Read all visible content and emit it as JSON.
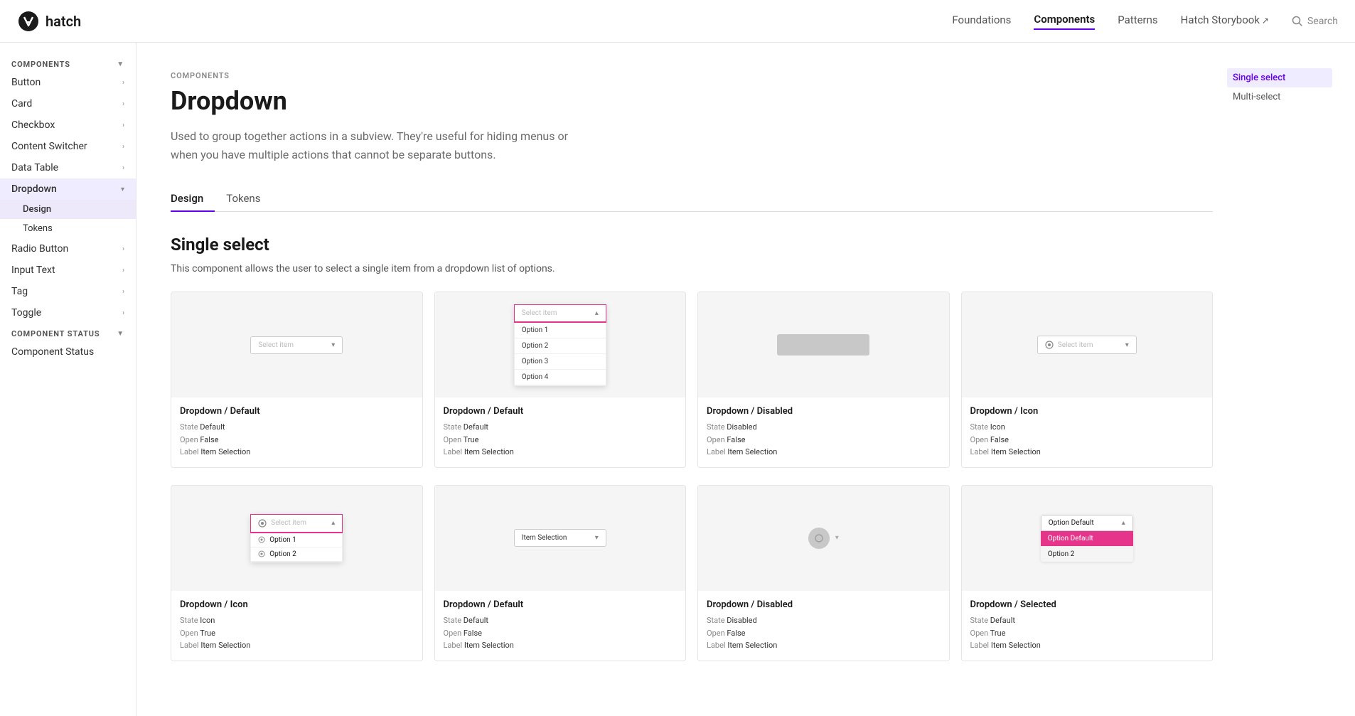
{
  "header": {
    "logo_text": "hatch",
    "nav_items": [
      {
        "label": "Foundations",
        "active": false,
        "external": false
      },
      {
        "label": "Components",
        "active": true,
        "external": false
      },
      {
        "label": "Patterns",
        "active": false,
        "external": false
      },
      {
        "label": "Hatch Storybook",
        "active": false,
        "external": true
      }
    ],
    "search_label": "Search"
  },
  "sidebar": {
    "components_section": "COMPONENTS",
    "items": [
      {
        "label": "Button",
        "active": false,
        "expanded": false
      },
      {
        "label": "Card",
        "active": false,
        "expanded": false
      },
      {
        "label": "Checkbox",
        "active": false,
        "expanded": false
      },
      {
        "label": "Content Switcher",
        "active": false,
        "expanded": false
      },
      {
        "label": "Data Table",
        "active": false,
        "expanded": false
      },
      {
        "label": "Dropdown",
        "active": true,
        "expanded": true
      },
      {
        "label": "Radio Button",
        "active": false,
        "expanded": false
      },
      {
        "label": "Input Text",
        "active": false,
        "expanded": false
      },
      {
        "label": "Tag",
        "active": false,
        "expanded": false
      },
      {
        "label": "Toggle",
        "active": false,
        "expanded": false
      }
    ],
    "dropdown_sub_items": [
      {
        "label": "Design",
        "active": true
      },
      {
        "label": "Tokens",
        "active": false
      }
    ],
    "component_status_section": "COMPONENT STATUS",
    "status_items": [
      {
        "label": "Component Status",
        "active": false
      }
    ]
  },
  "main": {
    "breadcrumb": "COMPONENTS",
    "title": "Dropdown",
    "description": "Used to group together actions in a subview. They're useful for hiding menus or when you have multiple actions that cannot be separate buttons.",
    "tabs": [
      {
        "label": "Design",
        "active": true
      },
      {
        "label": "Tokens",
        "active": false
      }
    ],
    "section_title": "Single select",
    "section_description": "This component allows the user to select a single item from a dropdown list of options.",
    "cards": [
      {
        "title": "Dropdown / Default",
        "meta": [
          {
            "label": "State",
            "value": "Default"
          },
          {
            "label": "Open",
            "value": "False"
          },
          {
            "label": "Label",
            "value": "Item Selection"
          }
        ],
        "type": "default-closed"
      },
      {
        "title": "Dropdown / Default",
        "meta": [
          {
            "label": "State",
            "value": "Default"
          },
          {
            "label": "Open",
            "value": "True"
          },
          {
            "label": "Label",
            "value": "Item Selection"
          }
        ],
        "type": "default-open"
      },
      {
        "title": "Dropdown / Disabled",
        "meta": [
          {
            "label": "State",
            "value": "Disabled"
          },
          {
            "label": "Open",
            "value": "False"
          },
          {
            "label": "Label",
            "value": "Item Selection"
          }
        ],
        "type": "disabled"
      },
      {
        "title": "Dropdown / Icon",
        "meta": [
          {
            "label": "State",
            "value": "Icon"
          },
          {
            "label": "Open",
            "value": "False"
          },
          {
            "label": "Label",
            "value": "Item Selection"
          }
        ],
        "type": "icon"
      },
      {
        "title": "Dropdown / Icon",
        "meta": [
          {
            "label": "State",
            "value": "Icon"
          },
          {
            "label": "Open",
            "value": "True"
          },
          {
            "label": "Label",
            "value": "Item Selection"
          }
        ],
        "type": "icon-open"
      },
      {
        "title": "Dropdown / Default",
        "meta": [
          {
            "label": "State",
            "value": "Default"
          },
          {
            "label": "Open",
            "value": "False"
          },
          {
            "label": "Label",
            "value": "Item Selection"
          }
        ],
        "type": "selection"
      },
      {
        "title": "Dropdown / Disabled",
        "meta": [
          {
            "label": "State",
            "value": "Disabled"
          },
          {
            "label": "Open",
            "value": "False"
          },
          {
            "label": "Label",
            "value": "Item Selection"
          }
        ],
        "type": "disabled-icon"
      },
      {
        "title": "Dropdown / Selected",
        "meta": [
          {
            "label": "State",
            "value": "Default"
          },
          {
            "label": "Open",
            "value": "True"
          },
          {
            "label": "Label",
            "value": "Item Selection"
          }
        ],
        "type": "selected-open"
      }
    ],
    "dropdown_options": [
      "Option 1",
      "Option 2",
      "Option 3",
      "Option 4"
    ]
  },
  "right_sidebar": {
    "items": [
      {
        "label": "Single select",
        "active": true
      },
      {
        "label": "Multi-select",
        "active": false
      }
    ]
  }
}
